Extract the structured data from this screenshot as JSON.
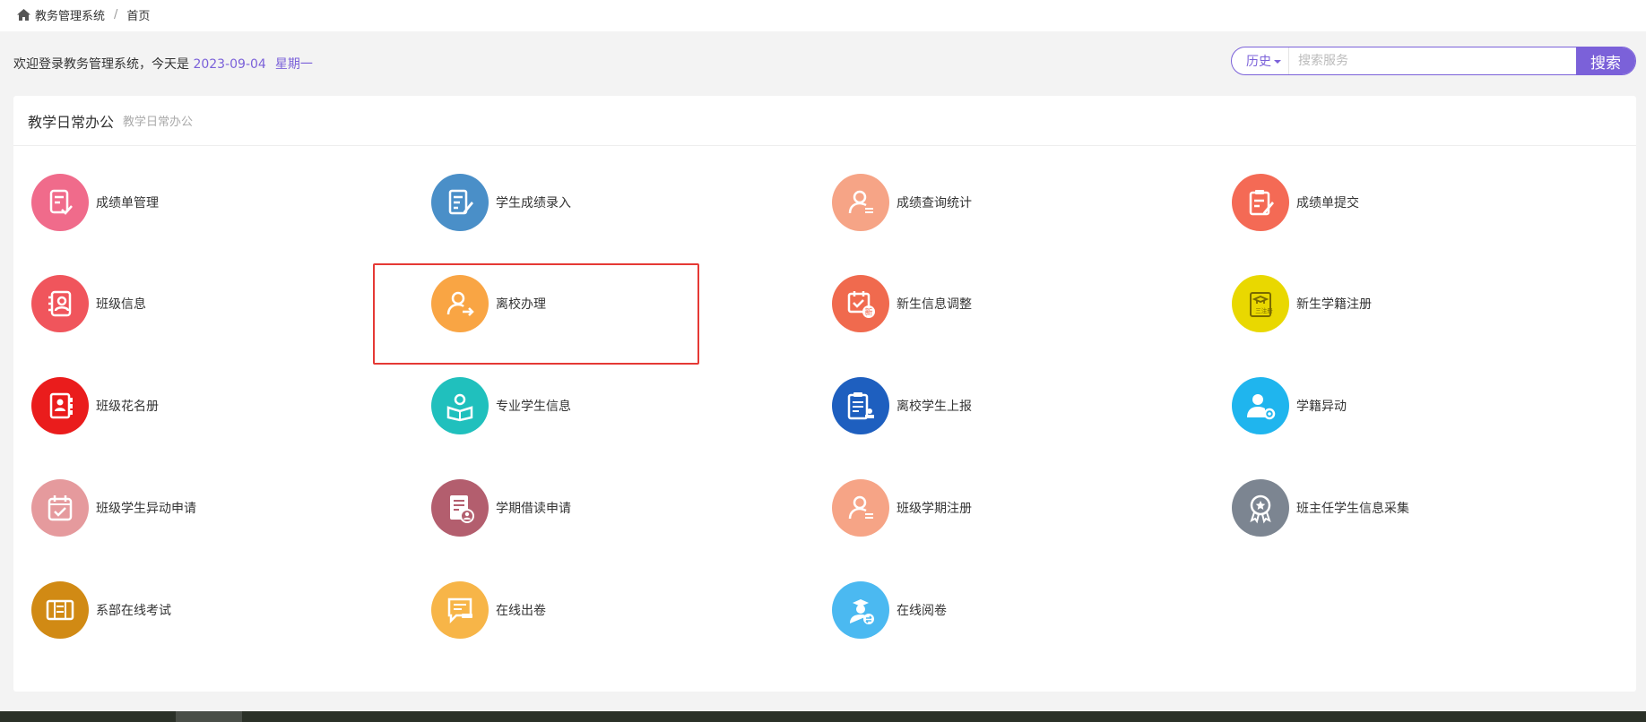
{
  "breadcrumb": {
    "system": "教务管理系统",
    "separator": "/",
    "current": "首页"
  },
  "welcome": {
    "prefix": "欢迎登录教务管理系统，今天是 ",
    "date": "2023-09-04",
    "weekday": "星期一"
  },
  "search": {
    "history_label": "历史",
    "placeholder": "搜索服务",
    "button_label": "搜索"
  },
  "panel": {
    "title": "教学日常办公",
    "subtitle": "教学日常办公"
  },
  "tiles": [
    {
      "label": "成绩单管理",
      "icon": "report-check-icon",
      "color": "#f06b8b"
    },
    {
      "label": "学生成绩录入",
      "icon": "document-edit-icon",
      "color": "#4a8fc8"
    },
    {
      "label": "成绩查询统计",
      "icon": "user-list-icon",
      "color": "#f6a486"
    },
    {
      "label": "成绩单提交",
      "icon": "clipboard-edit-icon",
      "color": "#f46a55"
    },
    {
      "label": "班级信息",
      "icon": "contact-card-icon",
      "color": "#f0555c"
    },
    {
      "label": "离校办理",
      "icon": "user-leave-icon",
      "color": "#f9a544"
    },
    {
      "label": "新生信息调整",
      "icon": "calendar-new-icon",
      "color": "#f06a4e"
    },
    {
      "label": "新生学籍注册",
      "icon": "graduation-register-icon",
      "color": "#e9d800"
    },
    {
      "label": "班级花名册",
      "icon": "roster-book-icon",
      "color": "#ea1c1c"
    },
    {
      "label": "专业学生信息",
      "icon": "student-book-icon",
      "color": "#20c0bd"
    },
    {
      "label": "离校学生上报",
      "icon": "clipboard-stamp-icon",
      "color": "#1e5fbf"
    },
    {
      "label": "学籍异动",
      "icon": "user-gear-icon",
      "color": "#1fb5ee"
    },
    {
      "label": "班级学生异动申请",
      "icon": "calendar-check-icon",
      "color": "#e59a9d"
    },
    {
      "label": "学期借读申请",
      "icon": "document-person-icon",
      "color": "#b35e6e"
    },
    {
      "label": "班级学期注册",
      "icon": "user-list-icon",
      "color": "#f6a486"
    },
    {
      "label": "班主任学生信息采集",
      "icon": "award-badge-icon",
      "color": "#7c8591"
    },
    {
      "label": "系部在线考试",
      "icon": "exam-paper-icon",
      "color": "#d18a14"
    },
    {
      "label": "在线出卷",
      "icon": "chat-pencil-icon",
      "color": "#f7b548"
    },
    {
      "label": "在线阅卷",
      "icon": "teacher-exchange-icon",
      "color": "#4bb9f1"
    }
  ]
}
